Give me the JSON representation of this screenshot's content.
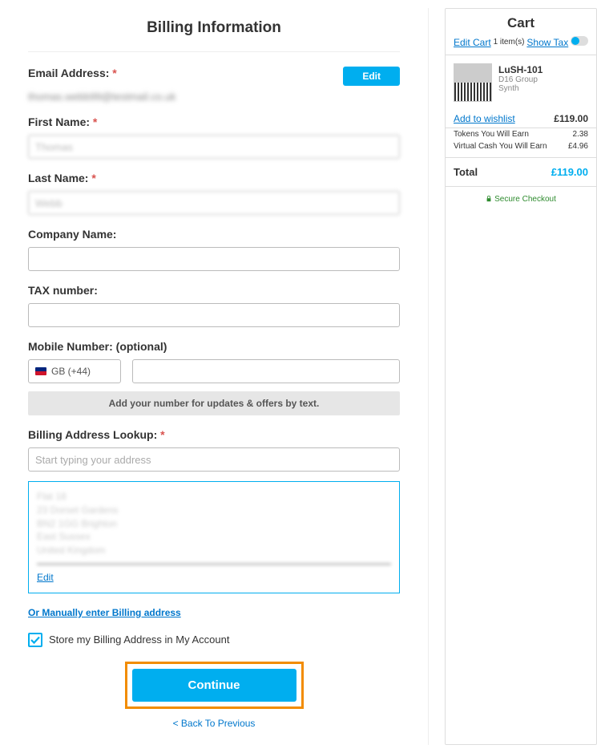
{
  "title": "Billing Information",
  "email": {
    "label": "Email Address:",
    "value": "thomas.webb99@testmail.co.uk",
    "edit_btn": "Edit"
  },
  "first_name": {
    "label": "First Name:",
    "value": "Thomas"
  },
  "last_name": {
    "label": "Last Name:",
    "value": "Webb"
  },
  "company": {
    "label": "Company Name:",
    "value": ""
  },
  "tax": {
    "label": "TAX number:",
    "value": ""
  },
  "mobile": {
    "label": "Mobile Number: (optional)",
    "cc": "GB (+44)",
    "value": "",
    "notice": "Add your number for updates & offers by text."
  },
  "lookup": {
    "label": "Billing Address Lookup:",
    "placeholder": "Start typing your address"
  },
  "address": {
    "lines": [
      "Flat 18",
      "23 Dorset Gardens",
      "BN2 1GG Brighton",
      "East Sussex",
      "United Kingdom"
    ],
    "edit": "Edit"
  },
  "manual_link": "Or Manually enter Billing address",
  "store_label": "Store my Billing Address in My Account",
  "continue_btn": "Continue",
  "back_link": "< Back To Previous",
  "cart": {
    "title": "Cart",
    "edit": "Edit Cart",
    "count": "1 item(s)",
    "show_tax": "Show Tax",
    "item": {
      "name": "LuSH-101",
      "brand": "D16 Group",
      "cat": "Synth"
    },
    "wishlist": "Add to wishlist",
    "price": "£119.00",
    "tokens_label": "Tokens You Will Earn",
    "tokens": "2.38",
    "vc_label": "Virtual Cash You Will Earn",
    "vc": "£4.96",
    "total_label": "Total",
    "total": "£119.00",
    "secure": "Secure Checkout"
  }
}
